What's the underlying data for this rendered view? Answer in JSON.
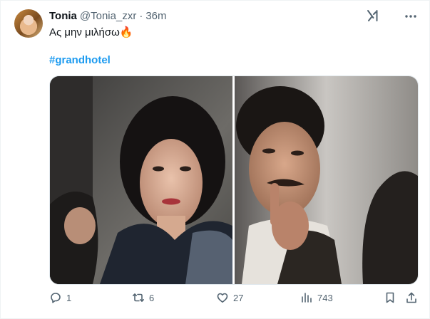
{
  "author": {
    "name": "Tonia",
    "handle": "@Tonia_zxr",
    "separator": "·",
    "time": "36m"
  },
  "tweet": {
    "text": "Ας μην μιλήσω🔥",
    "hashtag": "#grandhotel"
  },
  "icons": {
    "grok": "grok-icon",
    "more": "more-icon",
    "reply": "reply-icon",
    "repost": "repost-icon",
    "like": "like-icon",
    "views": "views-icon",
    "bookmark": "bookmark-icon",
    "share": "share-icon"
  },
  "stats": {
    "replies": "1",
    "reposts": "6",
    "likes": "27",
    "views": "743"
  },
  "colors": {
    "accent": "#1d9bf0",
    "text": "#0f1419",
    "muted": "#536471"
  }
}
